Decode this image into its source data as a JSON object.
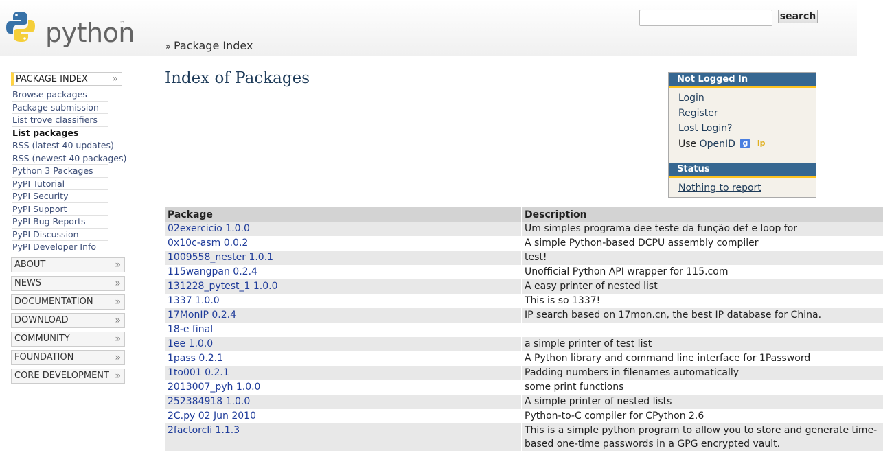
{
  "header": {
    "logo_text": "python",
    "logo_tm": "™",
    "search_placeholder": "",
    "search_value": "",
    "search_button": "search",
    "breadcrumb_sep": "»",
    "breadcrumb": "Package Index"
  },
  "sidebar": {
    "section_title": "PACKAGE INDEX",
    "links": [
      {
        "label": "Browse packages"
      },
      {
        "label": "Package submission"
      },
      {
        "label": "List trove classifiers"
      },
      {
        "label": "List packages"
      },
      {
        "label": "RSS (latest 40 updates)"
      },
      {
        "label": "RSS (newest 40 packages)"
      },
      {
        "label": "Python 3 Packages"
      },
      {
        "label": "PyPI Tutorial"
      },
      {
        "label": "PyPI Security"
      },
      {
        "label": "PyPI Support"
      },
      {
        "label": "PyPI Bug Reports"
      },
      {
        "label": "PyPI Discussion"
      },
      {
        "label": "PyPI Developer Info"
      }
    ],
    "active_index": 3,
    "menus": [
      {
        "label": "ABOUT"
      },
      {
        "label": "NEWS"
      },
      {
        "label": "DOCUMENTATION"
      },
      {
        "label": "DOWNLOAD"
      },
      {
        "label": "COMMUNITY"
      },
      {
        "label": "FOUNDATION"
      },
      {
        "label": "CORE DEVELOPMENT"
      }
    ],
    "chevron": "»"
  },
  "main": {
    "title": "Index of Packages"
  },
  "login_box": {
    "heading": "Not Logged In",
    "login": "Login",
    "register": "Register",
    "lost_login": "Lost Login?",
    "use_text": "Use",
    "openid": "OpenID",
    "google_badge": "g",
    "launchpad_badge": "lp",
    "status_heading": "Status",
    "status_text": "Nothing to report"
  },
  "table": {
    "headers": [
      "Package",
      "Description"
    ],
    "rows": [
      {
        "package": "02exercicio 1.0.0",
        "description": "Um simples programa dee teste da função def e loop for"
      },
      {
        "package": "0x10c-asm 0.0.2",
        "description": "A simple Python-based DCPU assembly compiler"
      },
      {
        "package": "1009558_nester 1.0.1",
        "description": "test!"
      },
      {
        "package": "115wangpan 0.2.4",
        "description": "Unofficial Python API wrapper for 115.com"
      },
      {
        "package": "131228_pytest_1 1.0.0",
        "description": "A easy printer of nested list"
      },
      {
        "package": "1337 1.0.0",
        "description": "This is so 1337!"
      },
      {
        "package": "17MonIP 0.2.4",
        "description": "IP search based on 17mon.cn, the best IP database for China."
      },
      {
        "package": "18-e final",
        "description": ""
      },
      {
        "package": "1ee 1.0.0",
        "description": "a simple printer of test list"
      },
      {
        "package": "1pass 0.2.1",
        "description": "A Python library and command line interface for 1Password"
      },
      {
        "package": "1to001 0.2.1",
        "description": "Padding numbers in filenames automatically"
      },
      {
        "package": "2013007_pyh 1.0.0",
        "description": "some print functions"
      },
      {
        "package": "252384918 1.0.0",
        "description": "A simple printer of nested lists"
      },
      {
        "package": "2C.py 02 Jun 2010",
        "description": "Python-to-C compiler for CPython 2.6"
      },
      {
        "package": "2factorcli 1.1.3",
        "description": "This is a simple python program to allow you to store and generate time-based one-time passwords in a GPG encrypted vault."
      }
    ]
  },
  "colors": {
    "accent_yellow": "#ffd343",
    "python_blue": "#366791",
    "link": "#1f3c9a"
  }
}
